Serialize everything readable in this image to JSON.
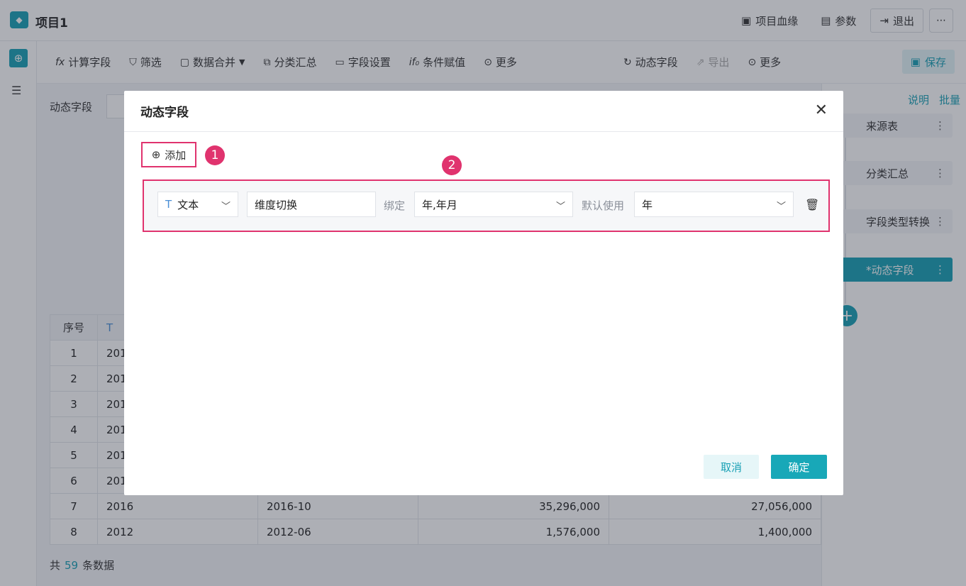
{
  "app": {
    "title": "项目1"
  },
  "topbar": {
    "lineage": "项目血缘",
    "params": "参数",
    "exit": "退出"
  },
  "toolbar": {
    "items": [
      "计算字段",
      "筛选",
      "数据合并",
      "分类汇总",
      "字段设置",
      "条件赋值",
      "更多"
    ],
    "dynamic": "动态字段",
    "export": "导出",
    "more": "更多",
    "save": "保存"
  },
  "main": {
    "dynamic_label": "动态字段"
  },
  "table": {
    "headers": [
      "序号",
      "T"
    ],
    "rows": [
      [
        "1",
        "201",
        "",
        "",
        ""
      ],
      [
        "2",
        "201",
        "",
        "",
        ""
      ],
      [
        "3",
        "201",
        "",
        "",
        ""
      ],
      [
        "4",
        "201",
        "",
        "",
        ""
      ],
      [
        "5",
        "201",
        "",
        "",
        ""
      ],
      [
        "6",
        "201",
        "",
        "",
        ""
      ],
      [
        "7",
        "2016",
        "2016-10",
        "35,296,000",
        "27,056,000"
      ],
      [
        "8",
        "2012",
        "2012-06",
        "1,576,000",
        "1,400,000"
      ]
    ]
  },
  "footer": {
    "prefix": "共",
    "count": "59",
    "suffix": "条数据"
  },
  "right_panel": {
    "links": [
      "说明",
      "批量"
    ],
    "nodes": [
      "来源表",
      "分类汇总",
      "字段类型转换",
      "*动态字段"
    ]
  },
  "dialog": {
    "title": "动态字段",
    "add": "添加",
    "badge1": "1",
    "badge2": "2",
    "type_value": "文本",
    "name_value": "维度切换",
    "bind_label": "绑定",
    "bind_value": "年,年月",
    "default_label": "默认使用",
    "default_value": "年",
    "cancel": "取消",
    "confirm": "确定"
  },
  "colors": {
    "accent": "#18a0b5",
    "highlight": "#e0336e"
  }
}
